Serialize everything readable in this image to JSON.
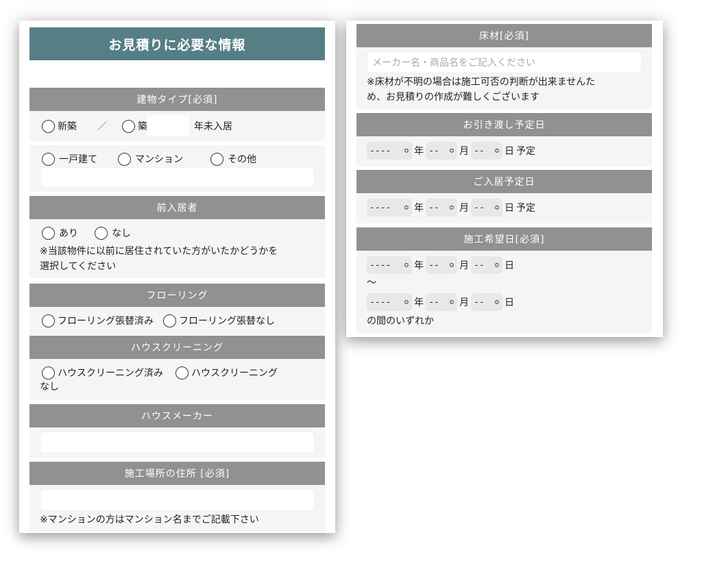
{
  "left": {
    "title": "お見積りに必要な情報",
    "building_type": {
      "header": "建物タイプ[必須]",
      "new": "新築",
      "separator": "／",
      "age_prefix": "築",
      "age_suffix": "年未入居",
      "detached": "一戸建て",
      "mansion": "マンション",
      "other": "その他"
    },
    "previous_resident": {
      "header": "前入居者",
      "yes": "あり",
      "no": "なし",
      "note_line1": "※当該物件に以前に居住されていた方がいたかどうかを",
      "note_line2": "選択してください"
    },
    "flooring": {
      "header": "フローリング",
      "replaced": "フローリング張替済み",
      "not_replaced": "フローリング張替なし"
    },
    "cleaning": {
      "header": "ハウスクリーニング",
      "done": "ハウスクリーニング済み",
      "not_done_line1": "ハウスクリーニング",
      "not_done_line2": "なし"
    },
    "maker": {
      "header": "ハウスメーカー"
    },
    "address": {
      "header": "施工場所の住所 [必須]",
      "note": "※マンションの方はマンション名までご記載下さい"
    }
  },
  "right": {
    "floor_material": {
      "header": "床材[必須]",
      "placeholder": "メーカー名・商品名をご記入ください",
      "note_line1": "※床材が不明の場合は施工可否の判断が出来ませんた",
      "note_line2": "め、お見積りの作成が難しくございます"
    },
    "handover": {
      "header": "お引き渡し予定日"
    },
    "move_in": {
      "header": "ご入居予定日"
    },
    "construction": {
      "header": "施工希望日[必須]",
      "tilde": "～",
      "footer": "の間のいずれか"
    },
    "date": {
      "year_value": "----",
      "small_value": "--",
      "year_unit": "年",
      "month_unit": "月",
      "day_unit": "日",
      "plan": "予定"
    }
  },
  "icons": {
    "select_arrow": "up-down-chevron-icon"
  },
  "colors": {
    "title_bg": "#557f85",
    "section_header_bg": "#919191",
    "section_body_bg": "#f4f5f7"
  }
}
